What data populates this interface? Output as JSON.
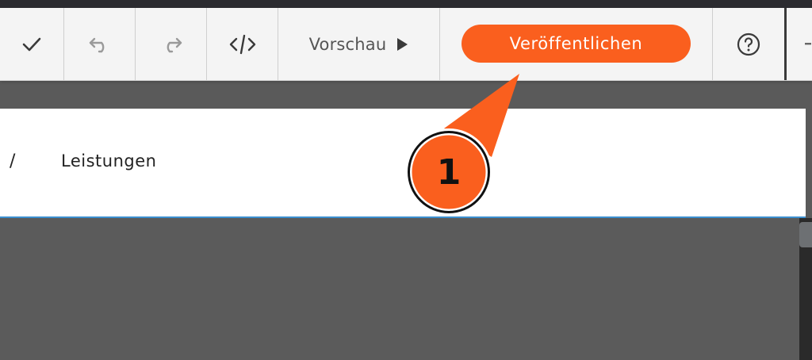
{
  "toolbar": {
    "preview_label": "Vorschau",
    "publish_label": "Veröffentlichen",
    "icons": [
      "check-icon",
      "undo-icon",
      "redo-icon",
      "code-icon",
      "play-icon",
      "help-icon"
    ]
  },
  "breadcrumb": {
    "separator": "/",
    "current": "Leistungen"
  },
  "annotation": {
    "number": "1"
  },
  "colors": {
    "accent": "#fa5f1e",
    "toolbar_bg": "#f4f4f4",
    "canvas_bg": "#5b5b5b",
    "underline": "#3b8fd0"
  }
}
